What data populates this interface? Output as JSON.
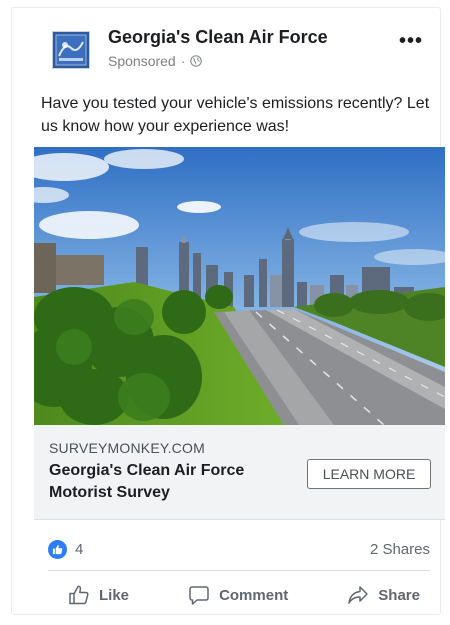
{
  "post": {
    "page_name": "Georgia's Clean Air Force",
    "sponsored_label": "Sponsored",
    "separator": "·",
    "more_label": "•••",
    "text": "Have you tested your vehicle's emissions recently? Let us know how your experience was!"
  },
  "link": {
    "domain": "SURVEYMONKEY.COM",
    "title": "Georgia's Clean Air Force Motorist Survey",
    "cta_label": "LEARN MORE"
  },
  "stats": {
    "reaction_count": "4",
    "shares": "2 Shares"
  },
  "actions": {
    "like": "Like",
    "comment": "Comment",
    "share": "Share"
  },
  "colors": {
    "facebook_blue": "#2e7df6",
    "logo_blue": "#2c5aa0",
    "text_dark": "#1c1e21",
    "text_muted": "#616770",
    "link_box_bg": "#f2f3f5"
  },
  "icons": {
    "logo": "georgia-clean-air-force-logo",
    "globe": "globe-icon",
    "reaction": "thumbs-up-reaction-icon",
    "like": "thumbs-up-outline-icon",
    "comment": "speech-bubble-icon",
    "share": "share-arrow-icon"
  }
}
